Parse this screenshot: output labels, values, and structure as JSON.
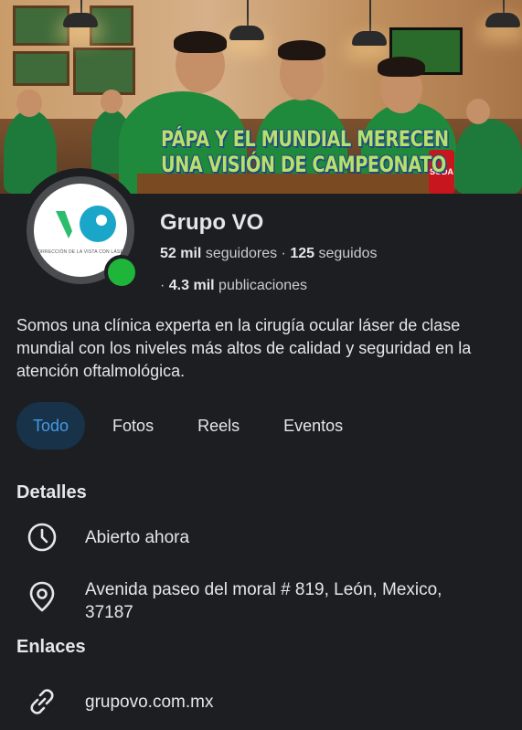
{
  "cover": {
    "headline_line1": "PÁPA Y EL MUNDIAL MERECEN",
    "headline_line2": "UNA VISIÓN DE CAMPEONATO",
    "can_label": "SODA"
  },
  "profile": {
    "name": "Grupo VO",
    "logo_tagline": "CORRECCIÓN DE LA VISTA CON LÁSER",
    "followers_count": "52 mil",
    "followers_label": "seguidores",
    "separator": "·",
    "following_count": "125",
    "following_label": "seguidos",
    "posts_count": "4.3 mil",
    "posts_label": "publicaciones",
    "bio": "Somos una clínica experta en la cirugía ocular láser de clase mundial con los niveles más altos de calidad y seguridad en la atención oftalmológica."
  },
  "tabs": [
    {
      "label": "Todo",
      "active": true
    },
    {
      "label": "Fotos",
      "active": false
    },
    {
      "label": "Reels",
      "active": false
    },
    {
      "label": "Eventos",
      "active": false
    }
  ],
  "details": {
    "title": "Detalles",
    "hours_icon": "clock-icon",
    "hours": "Abierto ahora",
    "address_icon": "location-pin-icon",
    "address_line1": "Avenida paseo del moral # 819, León, Mexico,",
    "address_line2": "37187"
  },
  "links": {
    "title": "Enlaces",
    "link_icon": "link-icon",
    "website": "grupovo.com.mx"
  },
  "colors": {
    "background": "#1c1e21",
    "accent_blue": "#4599e6",
    "active_tab_bg": "#183249",
    "online_green": "#1fb53a",
    "logo_green": "#2bbd6b",
    "logo_teal": "#1aa6c8"
  }
}
